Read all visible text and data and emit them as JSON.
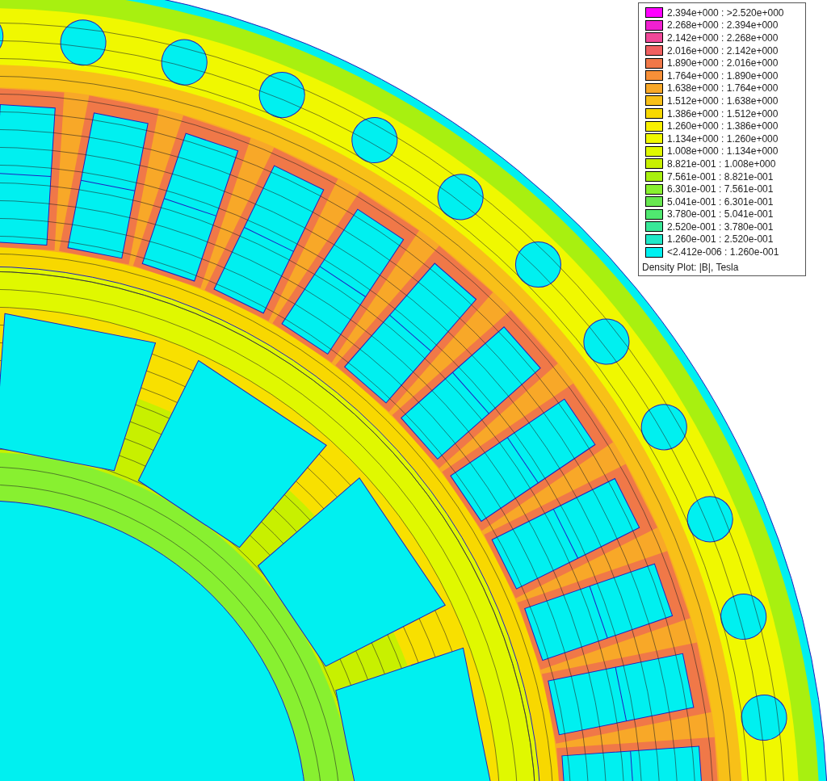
{
  "legend": {
    "entries": [
      {
        "range": "2.394e+000 : >2.520e+000",
        "color": "#ff00ff"
      },
      {
        "range": "2.268e+000 : 2.394e+000",
        "color": "#f020d0"
      },
      {
        "range": "2.142e+000 : 2.268e+000",
        "color": "#f04898"
      },
      {
        "range": "2.016e+000 : 2.142e+000",
        "color": "#f06060"
      },
      {
        "range": "1.890e+000 : 2.016e+000",
        "color": "#f07848"
      },
      {
        "range": "1.764e+000 : 1.890e+000",
        "color": "#f89038"
      },
      {
        "range": "1.638e+000 : 1.764e+000",
        "color": "#f8a828"
      },
      {
        "range": "1.512e+000 : 1.638e+000",
        "color": "#f8c018"
      },
      {
        "range": "1.386e+000 : 1.512e+000",
        "color": "#f8d800"
      },
      {
        "range": "1.260e+000 : 1.386e+000",
        "color": "#f8f000"
      },
      {
        "range": "1.134e+000 : 1.260e+000",
        "color": "#f0f800"
      },
      {
        "range": "1.008e+000 : 1.134e+000",
        "color": "#e0f800"
      },
      {
        "range": "8.821e-001 : 1.008e+000",
        "color": "#c8f000"
      },
      {
        "range": "7.561e-001 : 8.821e-001",
        "color": "#a8f010"
      },
      {
        "range": "6.301e-001 : 7.561e-001",
        "color": "#88f030"
      },
      {
        "range": "5.041e-001 : 6.301e-001",
        "color": "#68e850"
      },
      {
        "range": "3.780e-001 : 5.041e-001",
        "color": "#50e870"
      },
      {
        "range": "2.520e-001 : 3.780e-001",
        "color": "#38e898"
      },
      {
        "range": "1.260e-001 : 2.520e-001",
        "color": "#20e8c8"
      },
      {
        "range": "<2.412e-006 : 1.260e-001",
        "color": "#00f0f0"
      }
    ],
    "caption": "Density Plot: |B|, Tesla"
  }
}
